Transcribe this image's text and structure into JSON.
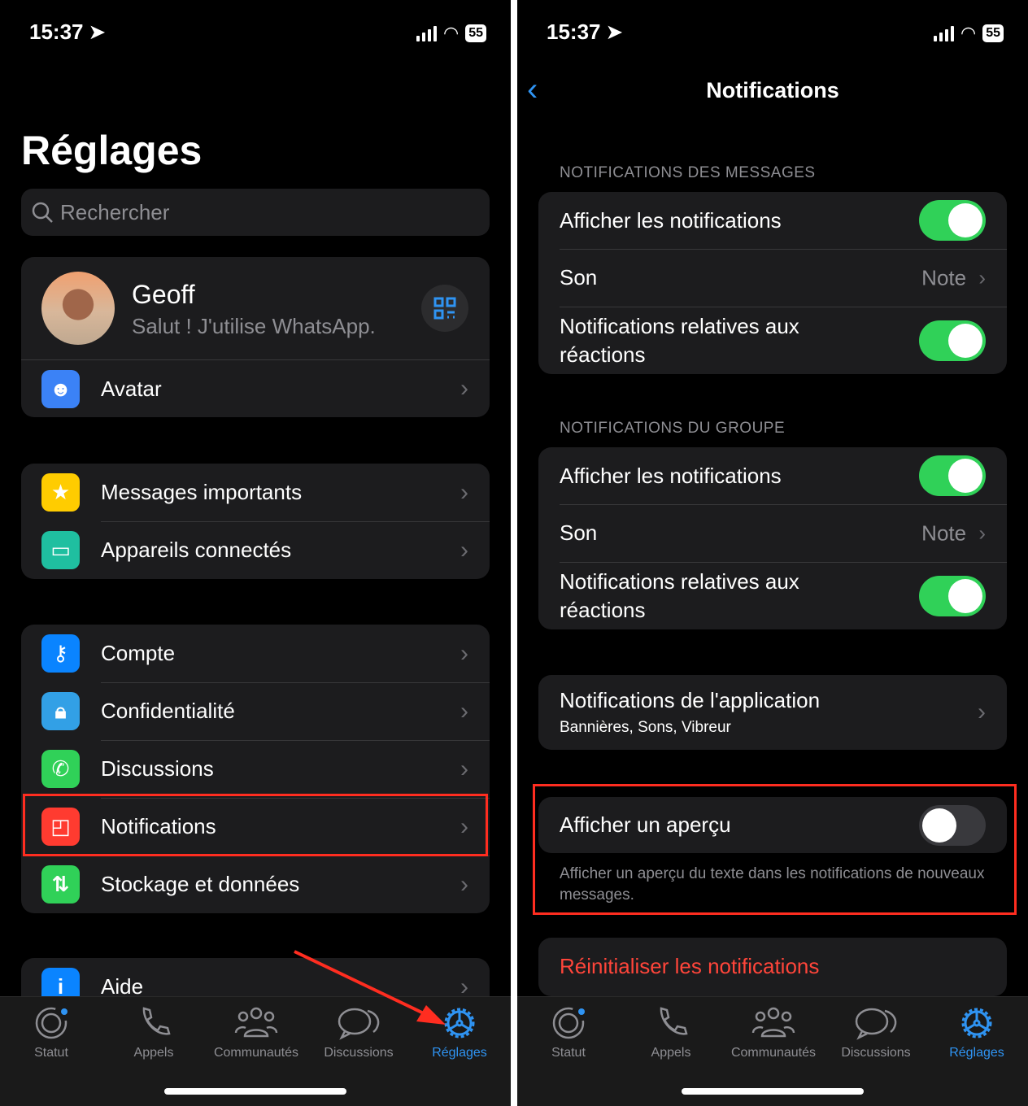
{
  "status": {
    "time": "15:37",
    "battery": "55"
  },
  "left": {
    "title": "Réglages",
    "search_placeholder": "Rechercher",
    "profile": {
      "name": "Geoff",
      "status": "Salut ! J'utilise WhatsApp."
    },
    "avatar_label": "Avatar",
    "group2": [
      "Messages importants",
      "Appareils connectés"
    ],
    "group3": [
      "Compte",
      "Confidentialité",
      "Discussions",
      "Notifications",
      "Stockage et données"
    ],
    "group4": [
      "Aide"
    ]
  },
  "right": {
    "title": "Notifications",
    "messages": {
      "header": "NOTIFICATIONS DES MESSAGES",
      "show": "Afficher les notifications",
      "show_on": true,
      "sound": "Son",
      "sound_value": "Note",
      "reactions": "Notifications relatives aux réactions",
      "reactions_on": true
    },
    "group": {
      "header": "NOTIFICATIONS DU GROUPE",
      "show": "Afficher les notifications",
      "show_on": true,
      "sound": "Son",
      "sound_value": "Note",
      "reactions": "Notifications relatives aux réactions",
      "reactions_on": true
    },
    "app": {
      "title": "Notifications de l'application",
      "subtitle": "Bannières, Sons, Vibreur"
    },
    "preview": {
      "label": "Afficher un aperçu",
      "on": false,
      "footer": "Afficher un aperçu du texte dans les notifications de nouveaux messages."
    },
    "reset": "Réinitialiser les notifications"
  },
  "tabs": [
    "Statut",
    "Appels",
    "Communautés",
    "Discussions",
    "Réglages"
  ],
  "active_tab": "Réglages",
  "colors": {
    "accent": "#2f94f3",
    "toggle_on": "#30d158",
    "highlight": "#ff2d20",
    "destructive": "#ff453a"
  }
}
